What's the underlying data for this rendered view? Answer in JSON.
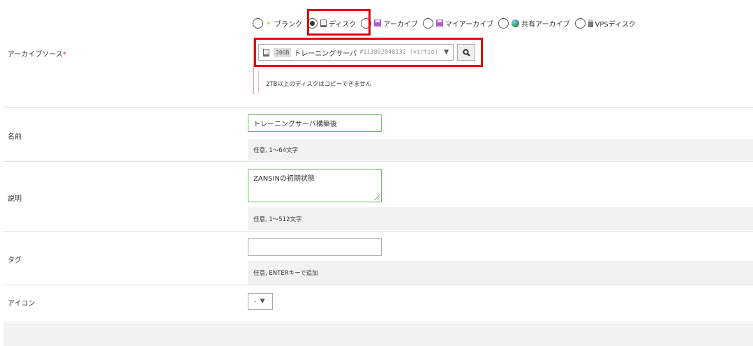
{
  "archive_source": {
    "label": "アーカイブソース",
    "required_mark": "*",
    "options": [
      {
        "label": "ブランク",
        "icon": "blank-icon",
        "checked": false
      },
      {
        "label": "ディスク",
        "icon": "disk-icon",
        "checked": true
      },
      {
        "label": "アーカイブ",
        "icon": "archive-icon",
        "checked": false
      },
      {
        "label": "マイアーカイブ",
        "icon": "archive-icon",
        "checked": false
      },
      {
        "label": "共有アーカイブ",
        "icon": "globe-icon",
        "checked": false
      },
      {
        "label": "VPSディスク",
        "icon": "vps-disk-icon",
        "checked": false
      }
    ],
    "select": {
      "size": "20GB",
      "name": "トレーニングサーバ",
      "id": "#113802048132 (virtio)",
      "caret": "▼"
    },
    "note": "2TB以上のディスクはコピーできません"
  },
  "name_field": {
    "label": "名前",
    "value": "トレーニングサーバ構築後",
    "help": "任意, 1〜64文字"
  },
  "description_field": {
    "label": "説明",
    "value": "ZANSINの初期状態",
    "help": "任意, 1〜512文字"
  },
  "tag_field": {
    "label": "タグ",
    "value": "",
    "help": "任意, ENTERキーで追加"
  },
  "icon_field": {
    "label": "アイコン",
    "value": "-",
    "caret": "▼"
  },
  "colors": {
    "highlight": "#e0000f",
    "valid_border": "#75b36a",
    "help_bg": "#f2f2f2"
  }
}
